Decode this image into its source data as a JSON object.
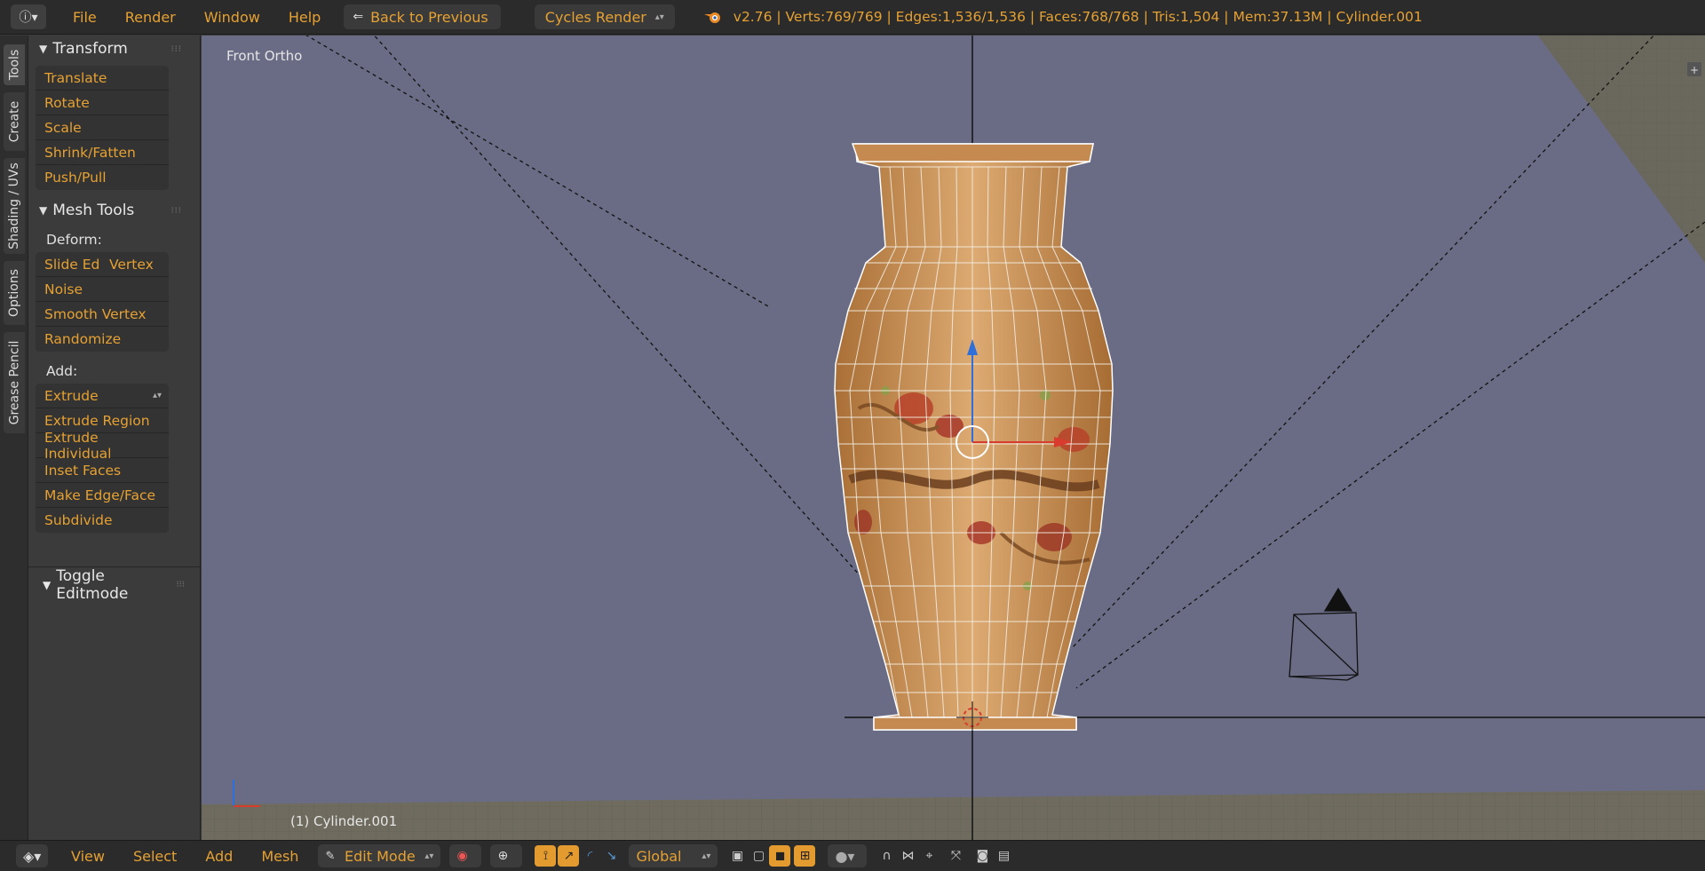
{
  "topbar": {
    "info_icon": "info-icon",
    "menus": [
      "File",
      "Render",
      "Window",
      "Help"
    ],
    "back_button": "Back to Previous",
    "render_engine": "Cycles Render",
    "stats": "v2.76 | Verts:769/769 | Edges:1,536/1,536 | Faces:768/768 | Tris:1,504 | Mem:37.13M | Cylinder.001"
  },
  "side_tabs": [
    "Tools",
    "Create",
    "Shading / UVs",
    "Options",
    "Grease Pencil"
  ],
  "transform": {
    "title": "Transform",
    "buttons": [
      "Translate",
      "Rotate",
      "Scale",
      "Shrink/Fatten",
      "Push/Pull"
    ]
  },
  "mesh_tools": {
    "title": "Mesh Tools",
    "deform_label": "Deform:",
    "slide_edge": "Slide Ed",
    "vertex": "Vertex",
    "deform_buttons": [
      "Noise",
      "Smooth Vertex",
      "Randomize"
    ],
    "add_label": "Add:",
    "extrude": "Extrude",
    "add_buttons": [
      "Extrude Region",
      "Extrude Individual",
      "Inset Faces",
      "Make Edge/Face",
      "Subdivide"
    ]
  },
  "toggle_editmode": "Toggle Editmode",
  "viewport": {
    "view_label": "Front Ortho",
    "object_label": "(1) Cylinder.001"
  },
  "bottombar": {
    "menus": [
      "View",
      "Select",
      "Add",
      "Mesh"
    ],
    "mode": "Edit Mode",
    "orientation": "Global"
  },
  "colors": {
    "accent": "#e6a133",
    "viewport_bg": "#6a6c85",
    "vase": "#c98f55"
  }
}
